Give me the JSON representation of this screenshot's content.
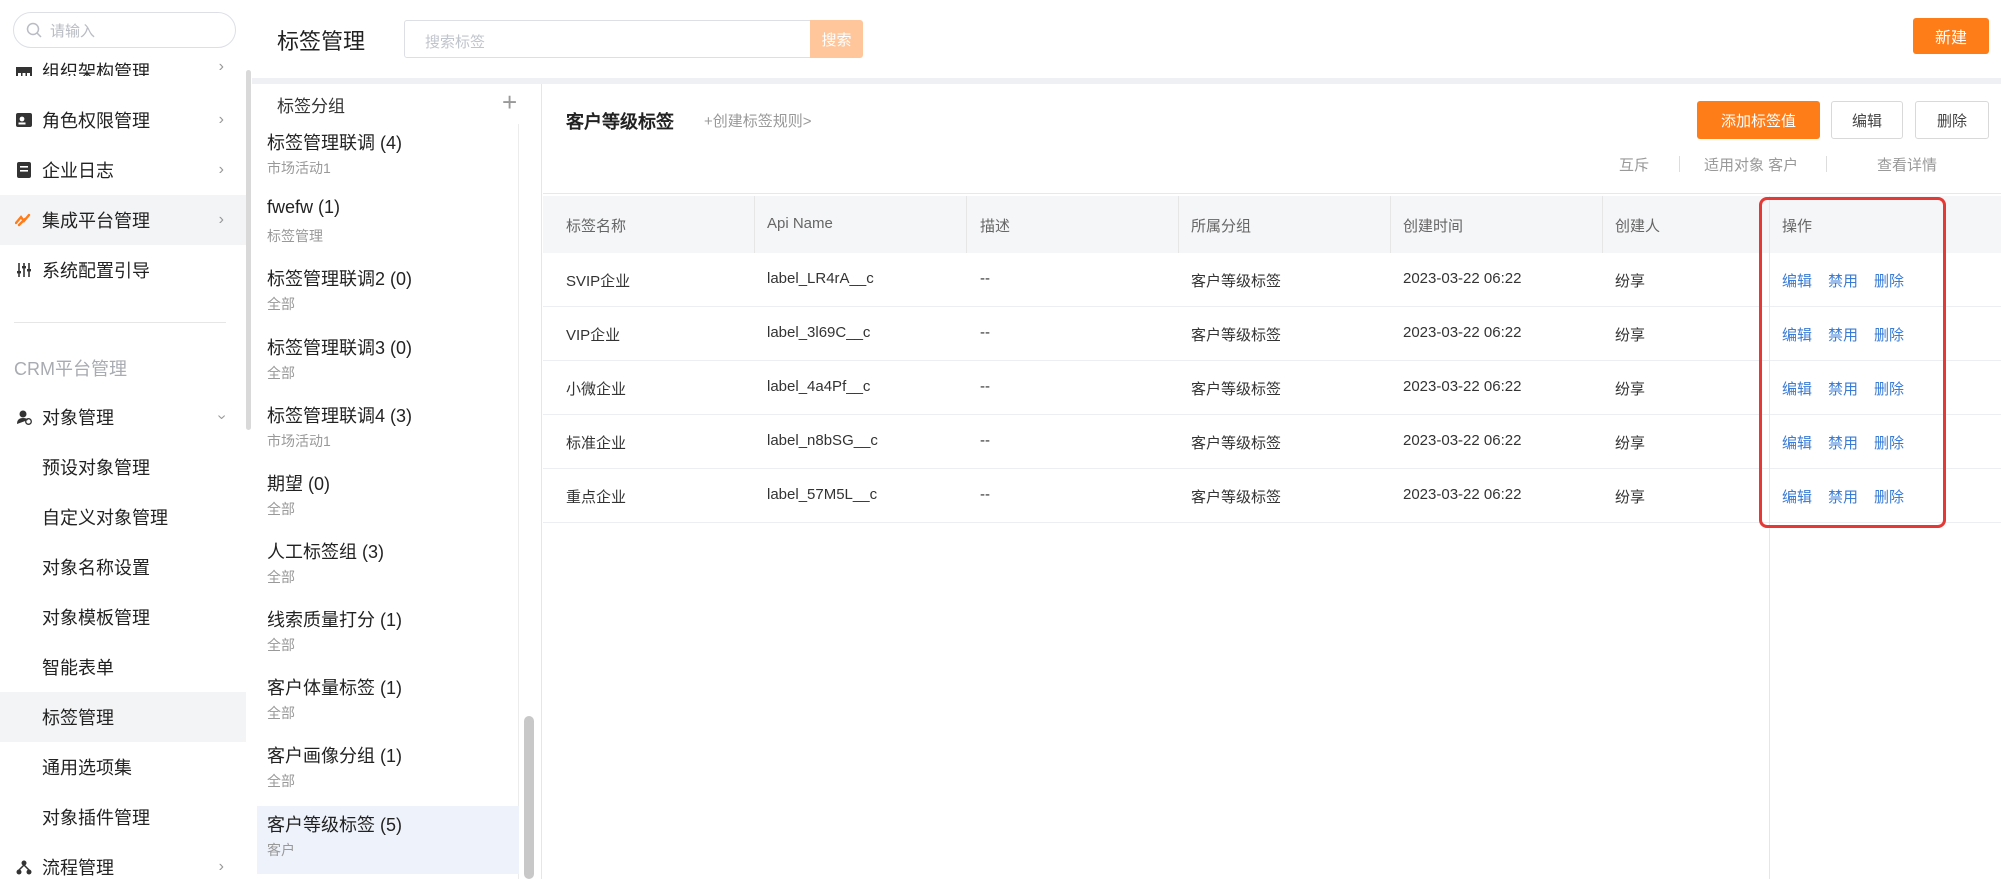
{
  "nav": {
    "search_placeholder": "请输入",
    "items": [
      {
        "label": "组织架构管理",
        "icon": "org-icon"
      },
      {
        "label": "角色权限管理",
        "icon": "role-icon"
      },
      {
        "label": "企业日志",
        "icon": "log-icon"
      },
      {
        "label": "集成平台管理",
        "icon": "integration-icon"
      },
      {
        "label": "系统配置引导",
        "icon": "config-icon"
      }
    ],
    "section_title": "CRM平台管理",
    "object_mgmt": "对象管理",
    "sub_items": [
      "预设对象管理",
      "自定义对象管理",
      "对象名称设置",
      "对象模板管理",
      "智能表单",
      "标签管理",
      "通用选项集",
      "对象插件管理"
    ],
    "flow_mgmt": "流程管理"
  },
  "topbar": {
    "title": "标签管理",
    "search_placeholder": "搜索标签",
    "search_button": "搜索",
    "new_button": "新建"
  },
  "groups": {
    "header": "标签分组",
    "add_icon": "plus-icon",
    "items": [
      {
        "name": "标签管理联调 (4)",
        "sub": "市场活动1"
      },
      {
        "name": "fwefw (1)",
        "sub": "标签管理"
      },
      {
        "name": "标签管理联调2 (0)",
        "sub": "全部"
      },
      {
        "name": "标签管理联调3 (0)",
        "sub": "全部"
      },
      {
        "name": "标签管理联调4 (3)",
        "sub": "市场活动1"
      },
      {
        "name": "期望 (0)",
        "sub": "全部"
      },
      {
        "name": "人工标签组 (3)",
        "sub": "全部"
      },
      {
        "name": "线索质量打分 (1)",
        "sub": "全部"
      },
      {
        "name": "客户体量标签 (1)",
        "sub": "全部"
      },
      {
        "name": "客户画像分组 (1)",
        "sub": "全部"
      },
      {
        "name": "客户等级标签 (5)",
        "sub": "客户"
      }
    ]
  },
  "main": {
    "label_name": "客户等级标签",
    "create_rule": "+创建标签规则>",
    "add_value_button": "添加标签值",
    "edit_button": "编辑",
    "delete_button": "删除",
    "meta_mutex": "互斥",
    "meta_target": "适用对象 客户",
    "meta_detail": "查看详情"
  },
  "table": {
    "headers": [
      "标签名称",
      "Api Name",
      "描述",
      "所属分组",
      "创建时间",
      "创建人",
      "操作"
    ],
    "rows": [
      [
        "SVIP企业",
        "label_LR4rA__c",
        "--",
        "客户等级标签",
        "2023-03-22 06:22",
        "纷享"
      ],
      [
        "VIP企业",
        "label_3l69C__c",
        "--",
        "客户等级标签",
        "2023-03-22 06:22",
        "纷享"
      ],
      [
        "小微企业",
        "label_4a4Pf__c",
        "--",
        "客户等级标签",
        "2023-03-22 06:22",
        "纷享"
      ],
      [
        "标准企业",
        "label_n8bSG__c",
        "--",
        "客户等级标签",
        "2023-03-22 06:22",
        "纷享"
      ],
      [
        "重点企业",
        "label_57M5L__c",
        "--",
        "客户等级标签",
        "2023-03-22 06:22",
        "纷享"
      ]
    ],
    "ops": [
      "编辑",
      "禁用",
      "删除"
    ]
  },
  "colors": {
    "accent": "#ff7d19",
    "link": "#3a7bd5",
    "highlight": "#e53935"
  }
}
